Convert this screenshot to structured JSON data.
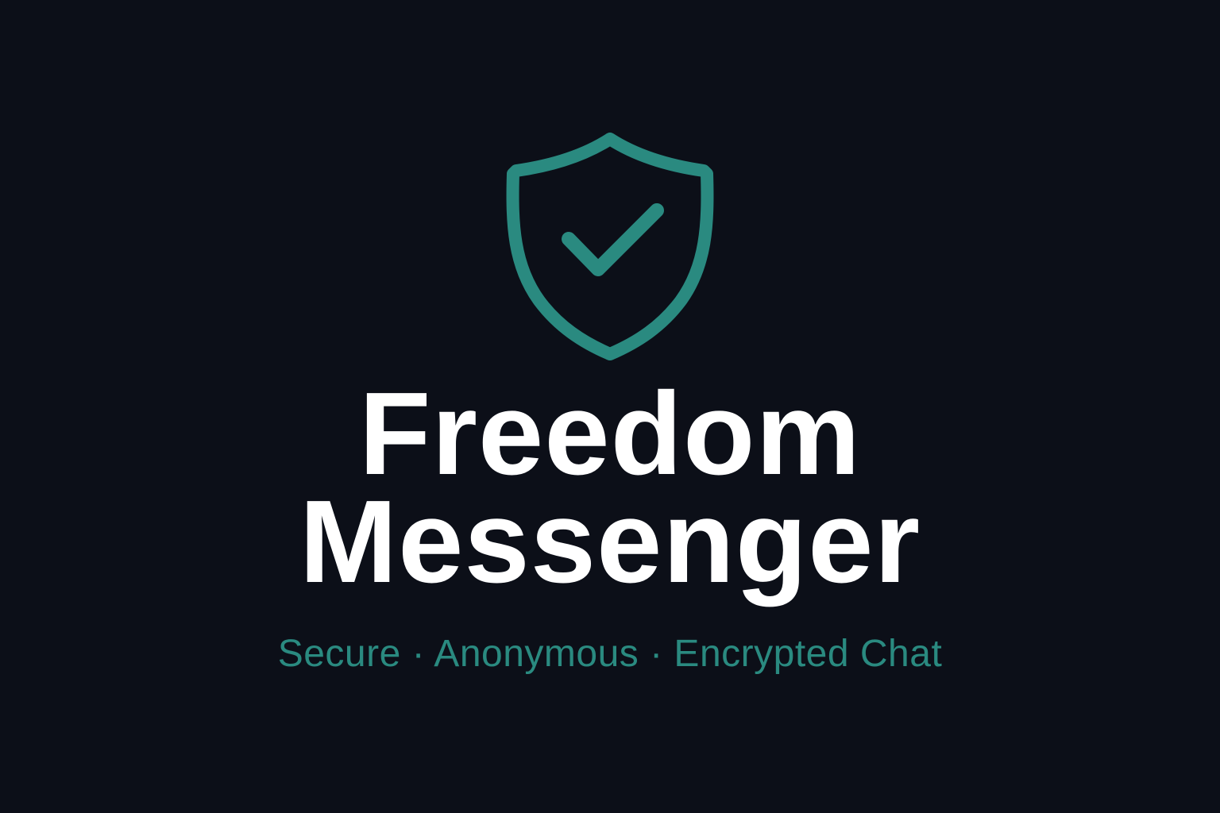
{
  "brand": {
    "icon": "shield-check-icon",
    "accent_color": "#2a8a80",
    "background_color": "#0c0f18",
    "title_color": "#ffffff",
    "title_line_1": "Freedom",
    "title_line_2": "Messenger",
    "tagline": "Secure · Anonymous · Encrypted Chat"
  }
}
